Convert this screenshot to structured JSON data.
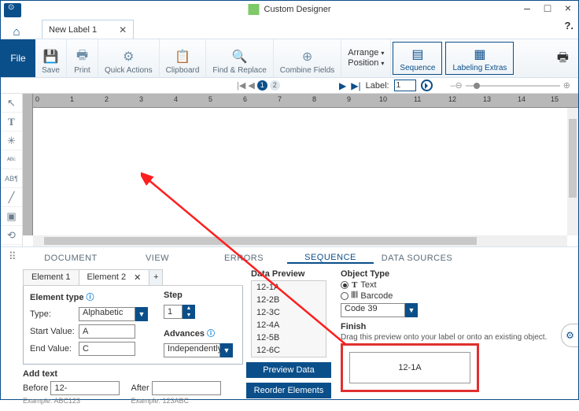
{
  "title": "Custom Designer",
  "tab": {
    "label": "New Label 1"
  },
  "help": "?.",
  "ribbon": {
    "file": "File",
    "save": "Save",
    "print": "Print",
    "quick": "Quick Actions",
    "clipboard": "Clipboard",
    "find": "Find & Replace",
    "combine": "Combine Fields",
    "arrange": "Arrange",
    "position": "Position",
    "sequence": "Sequence",
    "extras": "Labeling Extras"
  },
  "pager": {
    "p1": "1",
    "p2": "2",
    "label": "Label:",
    "value": "1"
  },
  "ruler": [
    "0",
    "1",
    "2",
    "3",
    "4",
    "5",
    "6",
    "7",
    "8",
    "9",
    "10",
    "11",
    "12",
    "13",
    "14",
    "15"
  ],
  "ptabs": {
    "doc": "DOCUMENT",
    "view": "VIEW",
    "err": "ERRORS",
    "seq": "SEQUENCE",
    "ds": "DATA SOURCES"
  },
  "el": {
    "t1": "Element 1",
    "t2": "Element 2",
    "plus": "+",
    "elementType": "Element type",
    "type": "Type:",
    "typeVal": "Alphabetic",
    "start": "Start Value:",
    "startVal": "A",
    "end": "End Value:",
    "endVal": "C",
    "step": "Step",
    "stepVal": "1",
    "adv": "Advances",
    "advVal": "Independently"
  },
  "add": {
    "title": "Add text",
    "before": "Before",
    "beforeVal": "12-",
    "after": "After",
    "ex1": "Example: ABC123",
    "ex2": "Example: 123ABC"
  },
  "dp": {
    "title": "Data Preview",
    "rows": [
      "12-1A",
      "12-2B",
      "12-3C",
      "12-4A",
      "12-5B",
      "12-6C"
    ],
    "btn1": "Preview Data",
    "btn2": "Reorder Elements"
  },
  "ot": {
    "title": "Object Type",
    "text": "Text",
    "barcode": "Barcode",
    "code": "Code 39"
  },
  "finish": {
    "title": "Finish",
    "hint": "Drag this preview onto your label or onto an existing object.",
    "preview": "12-1A"
  }
}
